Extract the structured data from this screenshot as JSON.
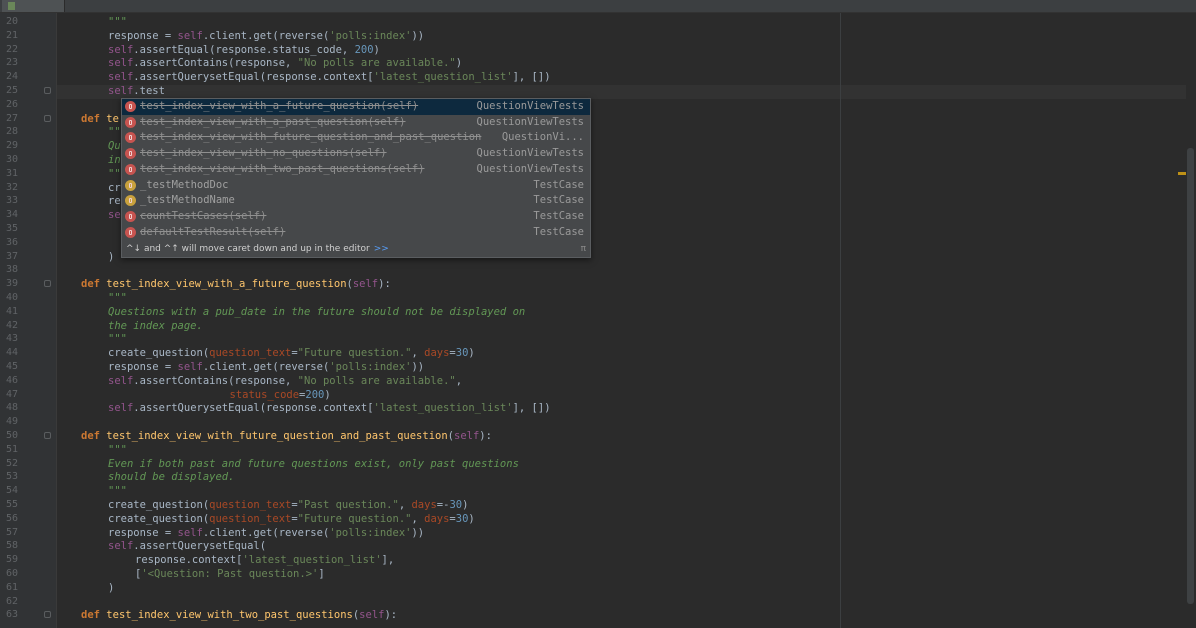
{
  "colors": {
    "background": "#2b2b2b",
    "keyword": "#cc7832",
    "function": "#ffc66d",
    "self": "#94558d",
    "string": "#6a8759",
    "number": "#6897bb",
    "parameter": "#aa4926",
    "docstring": "#629755",
    "selection": "#0d293e",
    "popup": "#46484a",
    "method_icon": "#c75450"
  },
  "lines": [
    {
      "n": "20",
      "indent": 4,
      "fold": false,
      "tokens": [
        {
          "c": "doc",
          "t": "\"\"\""
        }
      ]
    },
    {
      "n": "21",
      "indent": 4,
      "fold": false,
      "tokens": [
        {
          "c": "",
          "t": "response = "
        },
        {
          "c": "self",
          "t": "self"
        },
        {
          "c": "",
          "t": ".client.get(reverse("
        },
        {
          "c": "str",
          "t": "'polls:index'"
        },
        {
          "c": "",
          "t": "))"
        }
      ]
    },
    {
      "n": "22",
      "indent": 4,
      "fold": false,
      "tokens": [
        {
          "c": "self",
          "t": "self"
        },
        {
          "c": "",
          "t": ".assertEqual(response.status_code, "
        },
        {
          "c": "num",
          "t": "200"
        },
        {
          "c": "",
          "t": ")"
        }
      ]
    },
    {
      "n": "23",
      "indent": 4,
      "fold": false,
      "tokens": [
        {
          "c": "self",
          "t": "self"
        },
        {
          "c": "",
          "t": ".assertContains(response, "
        },
        {
          "c": "str",
          "t": "\"No polls are available.\""
        },
        {
          "c": "",
          "t": ")"
        }
      ]
    },
    {
      "n": "24",
      "indent": 4,
      "fold": false,
      "tokens": [
        {
          "c": "self",
          "t": "self"
        },
        {
          "c": "",
          "t": ".assertQuerysetEqual(response.context["
        },
        {
          "c": "str",
          "t": "'latest_question_list'"
        },
        {
          "c": "",
          "t": "], [])"
        }
      ]
    },
    {
      "n": "25",
      "indent": 4,
      "fold": true,
      "tokens": [
        {
          "c": "self",
          "t": "self"
        },
        {
          "c": "",
          "t": ".test"
        }
      ]
    },
    {
      "n": "26",
      "indent": 0,
      "fold": false,
      "tokens": []
    },
    {
      "n": "27",
      "indent": 0,
      "fold": true,
      "tokens": [
        {
          "c": "kw",
          "t": "def "
        },
        {
          "c": "fn",
          "t": "te"
        }
      ]
    },
    {
      "n": "28",
      "indent": 4,
      "fold": false,
      "tokens": [
        {
          "c": "doc",
          "t": "\"\""
        }
      ]
    },
    {
      "n": "29",
      "indent": 4,
      "fold": false,
      "tokens": [
        {
          "c": "doc",
          "t": "Qu"
        }
      ]
    },
    {
      "n": "30",
      "indent": 4,
      "fold": false,
      "tokens": [
        {
          "c": "doc",
          "t": "in"
        }
      ]
    },
    {
      "n": "31",
      "indent": 4,
      "fold": false,
      "tokens": [
        {
          "c": "doc",
          "t": "\"\""
        }
      ]
    },
    {
      "n": "32",
      "indent": 4,
      "fold": false,
      "tokens": [
        {
          "c": "",
          "t": "cr"
        }
      ]
    },
    {
      "n": "33",
      "indent": 4,
      "fold": false,
      "tokens": [
        {
          "c": "",
          "t": "re"
        }
      ]
    },
    {
      "n": "34",
      "indent": 4,
      "fold": false,
      "tokens": [
        {
          "c": "self",
          "t": "se"
        }
      ]
    },
    {
      "n": "35",
      "indent": 0,
      "fold": false,
      "tokens": []
    },
    {
      "n": "36",
      "indent": 0,
      "fold": false,
      "tokens": []
    },
    {
      "n": "37",
      "indent": 4,
      "fold": false,
      "tokens": [
        {
          "c": "",
          "t": ")"
        }
      ]
    },
    {
      "n": "38",
      "indent": 0,
      "fold": false,
      "tokens": []
    },
    {
      "n": "39",
      "indent": 0,
      "fold": true,
      "tokens": [
        {
          "c": "kw",
          "t": "def "
        },
        {
          "c": "fn",
          "t": "test_index_view_with_a_future_question"
        },
        {
          "c": "",
          "t": "("
        },
        {
          "c": "self",
          "t": "self"
        },
        {
          "c": "",
          "t": "):"
        }
      ]
    },
    {
      "n": "40",
      "indent": 4,
      "fold": false,
      "tokens": [
        {
          "c": "doc",
          "t": "\"\"\""
        }
      ]
    },
    {
      "n": "41",
      "indent": 4,
      "fold": false,
      "tokens": [
        {
          "c": "doc",
          "t": "Questions with a pub_date in the future should not be displayed on"
        }
      ]
    },
    {
      "n": "42",
      "indent": 4,
      "fold": false,
      "tokens": [
        {
          "c": "doc",
          "t": "the index page."
        }
      ]
    },
    {
      "n": "43",
      "indent": 4,
      "fold": false,
      "tokens": [
        {
          "c": "doc",
          "t": "\"\"\""
        }
      ]
    },
    {
      "n": "44",
      "indent": 4,
      "fold": false,
      "tokens": [
        {
          "c": "",
          "t": "create_question("
        },
        {
          "c": "param",
          "t": "question_text"
        },
        {
          "c": "",
          "t": "="
        },
        {
          "c": "str",
          "t": "\"Future question.\""
        },
        {
          "c": "",
          "t": ", "
        },
        {
          "c": "param",
          "t": "days"
        },
        {
          "c": "",
          "t": "="
        },
        {
          "c": "num",
          "t": "30"
        },
        {
          "c": "",
          "t": ")"
        }
      ]
    },
    {
      "n": "45",
      "indent": 4,
      "fold": false,
      "tokens": [
        {
          "c": "",
          "t": "response = "
        },
        {
          "c": "self",
          "t": "self"
        },
        {
          "c": "",
          "t": ".client.get(reverse("
        },
        {
          "c": "str",
          "t": "'polls:index'"
        },
        {
          "c": "",
          "t": "))"
        }
      ]
    },
    {
      "n": "46",
      "indent": 4,
      "fold": false,
      "tokens": [
        {
          "c": "self",
          "t": "self"
        },
        {
          "c": "",
          "t": ".assertContains(response, "
        },
        {
          "c": "str",
          "t": "\"No polls are available.\""
        },
        {
          "c": "",
          "t": ","
        }
      ]
    },
    {
      "n": "47",
      "indent": 22,
      "fold": false,
      "tokens": [
        {
          "c": "param",
          "t": "status_code"
        },
        {
          "c": "",
          "t": "="
        },
        {
          "c": "num",
          "t": "200"
        },
        {
          "c": "",
          "t": ")"
        }
      ]
    },
    {
      "n": "48",
      "indent": 4,
      "fold": false,
      "tokens": [
        {
          "c": "self",
          "t": "self"
        },
        {
          "c": "",
          "t": ".assertQuerysetEqual(response.context["
        },
        {
          "c": "str",
          "t": "'latest_question_list'"
        },
        {
          "c": "",
          "t": "], [])"
        }
      ]
    },
    {
      "n": "49",
      "indent": 0,
      "fold": false,
      "tokens": []
    },
    {
      "n": "50",
      "indent": 0,
      "fold": true,
      "tokens": [
        {
          "c": "kw",
          "t": "def "
        },
        {
          "c": "fn",
          "t": "test_index_view_with_future_question_and_past_question"
        },
        {
          "c": "",
          "t": "("
        },
        {
          "c": "self",
          "t": "self"
        },
        {
          "c": "",
          "t": "):"
        }
      ]
    },
    {
      "n": "51",
      "indent": 4,
      "fold": false,
      "tokens": [
        {
          "c": "doc",
          "t": "\"\"\""
        }
      ]
    },
    {
      "n": "52",
      "indent": 4,
      "fold": false,
      "tokens": [
        {
          "c": "doc",
          "t": "Even if both past and future questions exist, only past questions"
        }
      ]
    },
    {
      "n": "53",
      "indent": 4,
      "fold": false,
      "tokens": [
        {
          "c": "doc",
          "t": "should be displayed."
        }
      ]
    },
    {
      "n": "54",
      "indent": 4,
      "fold": false,
      "tokens": [
        {
          "c": "doc",
          "t": "\"\"\""
        }
      ]
    },
    {
      "n": "55",
      "indent": 4,
      "fold": false,
      "tokens": [
        {
          "c": "",
          "t": "create_question("
        },
        {
          "c": "param",
          "t": "question_text"
        },
        {
          "c": "",
          "t": "="
        },
        {
          "c": "str",
          "t": "\"Past question.\""
        },
        {
          "c": "",
          "t": ", "
        },
        {
          "c": "param",
          "t": "days"
        },
        {
          "c": "",
          "t": "=-"
        },
        {
          "c": "num",
          "t": "30"
        },
        {
          "c": "",
          "t": ")"
        }
      ]
    },
    {
      "n": "56",
      "indent": 4,
      "fold": false,
      "tokens": [
        {
          "c": "",
          "t": "create_question("
        },
        {
          "c": "param",
          "t": "question_text"
        },
        {
          "c": "",
          "t": "="
        },
        {
          "c": "str",
          "t": "\"Future question.\""
        },
        {
          "c": "",
          "t": ", "
        },
        {
          "c": "param",
          "t": "days"
        },
        {
          "c": "",
          "t": "="
        },
        {
          "c": "num",
          "t": "30"
        },
        {
          "c": "",
          "t": ")"
        }
      ]
    },
    {
      "n": "57",
      "indent": 4,
      "fold": false,
      "tokens": [
        {
          "c": "",
          "t": "response = "
        },
        {
          "c": "self",
          "t": "self"
        },
        {
          "c": "",
          "t": ".client.get(reverse("
        },
        {
          "c": "str",
          "t": "'polls:index'"
        },
        {
          "c": "",
          "t": "))"
        }
      ]
    },
    {
      "n": "58",
      "indent": 4,
      "fold": false,
      "tokens": [
        {
          "c": "self",
          "t": "self"
        },
        {
          "c": "",
          "t": ".assertQuerysetEqual("
        }
      ]
    },
    {
      "n": "59",
      "indent": 8,
      "fold": false,
      "tokens": [
        {
          "c": "",
          "t": "response.context["
        },
        {
          "c": "str",
          "t": "'latest_question_list'"
        },
        {
          "c": "",
          "t": "],"
        }
      ]
    },
    {
      "n": "60",
      "indent": 8,
      "fold": false,
      "tokens": [
        {
          "c": "",
          "t": "["
        },
        {
          "c": "str",
          "t": "'<Question: Past question.>'"
        },
        {
          "c": "",
          "t": "]"
        }
      ]
    },
    {
      "n": "61",
      "indent": 4,
      "fold": false,
      "tokens": [
        {
          "c": "",
          "t": ")"
        }
      ]
    },
    {
      "n": "62",
      "indent": 0,
      "fold": false,
      "tokens": []
    },
    {
      "n": "63",
      "indent": 0,
      "fold": true,
      "tokens": [
        {
          "c": "kw",
          "t": "def "
        },
        {
          "c": "fn",
          "t": "test_index_view_with_two_past_questions"
        },
        {
          "c": "",
          "t": "("
        },
        {
          "c": "self",
          "t": "self"
        },
        {
          "c": "",
          "t": "):"
        }
      ]
    }
  ],
  "completion": {
    "items": [
      {
        "name": "test_index_view_with_a_future_question(self)",
        "type": "QuestionViewTests",
        "icon": "method-icon",
        "struck": true
      },
      {
        "name": "test_index_view_with_a_past_question(self)",
        "type": "QuestionViewTests",
        "icon": "method-icon",
        "struck": true
      },
      {
        "name": "test_index_view_with_future_question_and_past_question",
        "type": "QuestionVi...",
        "icon": "method-icon",
        "struck": true
      },
      {
        "name": "test_index_view_with_no_questions(self)",
        "type": "QuestionViewTests",
        "icon": "method-icon",
        "struck": true
      },
      {
        "name": "test_index_view_with_two_past_questions(self)",
        "type": "QuestionViewTests",
        "icon": "method-icon",
        "struck": true
      },
      {
        "name": "_testMethodDoc",
        "type": "TestCase",
        "icon": "field-icon",
        "struck": false
      },
      {
        "name": "_testMethodName",
        "type": "TestCase",
        "icon": "field-icon",
        "struck": false
      },
      {
        "name": "countTestCases(self)",
        "type": "TestCase",
        "icon": "method-icon",
        "struck": true
      },
      {
        "name": "defaultTestResult(self)",
        "type": "TestCase",
        "icon": "method-icon",
        "struck": true
      }
    ],
    "hint_text": "^↓ and ^↑ will move caret down and up in the editor",
    "hint_link": ">>",
    "hint_icon": "π"
  }
}
